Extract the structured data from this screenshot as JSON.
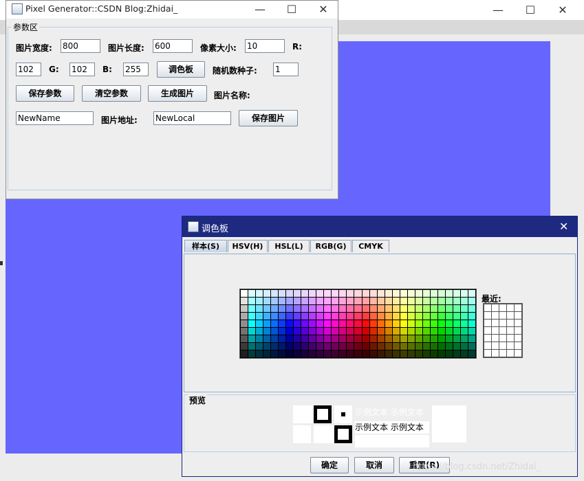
{
  "background_window": {
    "minimize": "—",
    "maximize": "☐",
    "close": "✕",
    "canvas_color": "#6666ff"
  },
  "main_window": {
    "title": "Pixel Generator::CSDN Blog:Zhidai_",
    "minimize": "—",
    "maximize": "☐",
    "close": "✕",
    "group_title": "参数区",
    "width_label": "图片宽度:",
    "width_value": "800",
    "height_label": "图片长度:",
    "height_value": "600",
    "pixel_label": "像素大小:",
    "pixel_value": "10",
    "r_label": "R:",
    "r_value": "102",
    "g_label": "G:",
    "g_value": "102",
    "b_label": "B:",
    "b_value": "255",
    "palette_button": "调色板",
    "seed_label": "随机数种子:",
    "seed_value": "1",
    "save_params": "保存参数",
    "clear_params": "清空参数",
    "generate": "生成图片",
    "name_label": "图片名称:",
    "name_value": "NewName",
    "addr_label": "图片地址:",
    "addr_value": "NewLocal",
    "save_image": "保存图片"
  },
  "dialog": {
    "title": "调色板",
    "close": "✕",
    "tabs": [
      "样本(S)",
      "HSV(H)",
      "HSL(L)",
      "RGB(G)",
      "CMYK"
    ],
    "recent_label": "最近:",
    "preview_label": "预览",
    "sample_text": "示例文本",
    "ok": "确定",
    "cancel": "取消",
    "reset": "重置(R)"
  },
  "watermark": "https://blog.csdn.net/Zhidai_"
}
